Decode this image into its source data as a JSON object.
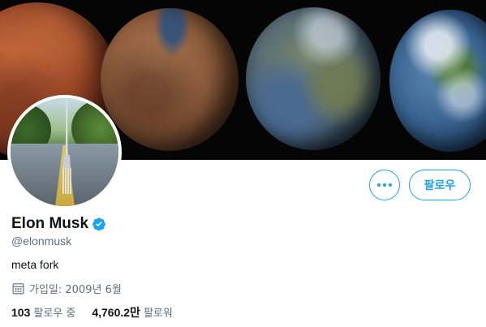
{
  "profile": {
    "name": "Elon Musk",
    "handle": "@elonmusk",
    "bio": "meta fork",
    "joined": "가입일: 2009년 6월",
    "following_count": "103",
    "following_label": "팔로우 중",
    "followers_count": "4,760.2만",
    "followers_label": "팔로워"
  },
  "actions": {
    "follow_label": "팔로우"
  },
  "icons": {
    "more": "more-horizontal-icon",
    "verified": "verified-badge-icon",
    "calendar": "calendar-icon"
  },
  "colors": {
    "accent": "#1da1f2",
    "secondary_text": "#5b7083",
    "primary_text": "#0f1419"
  }
}
